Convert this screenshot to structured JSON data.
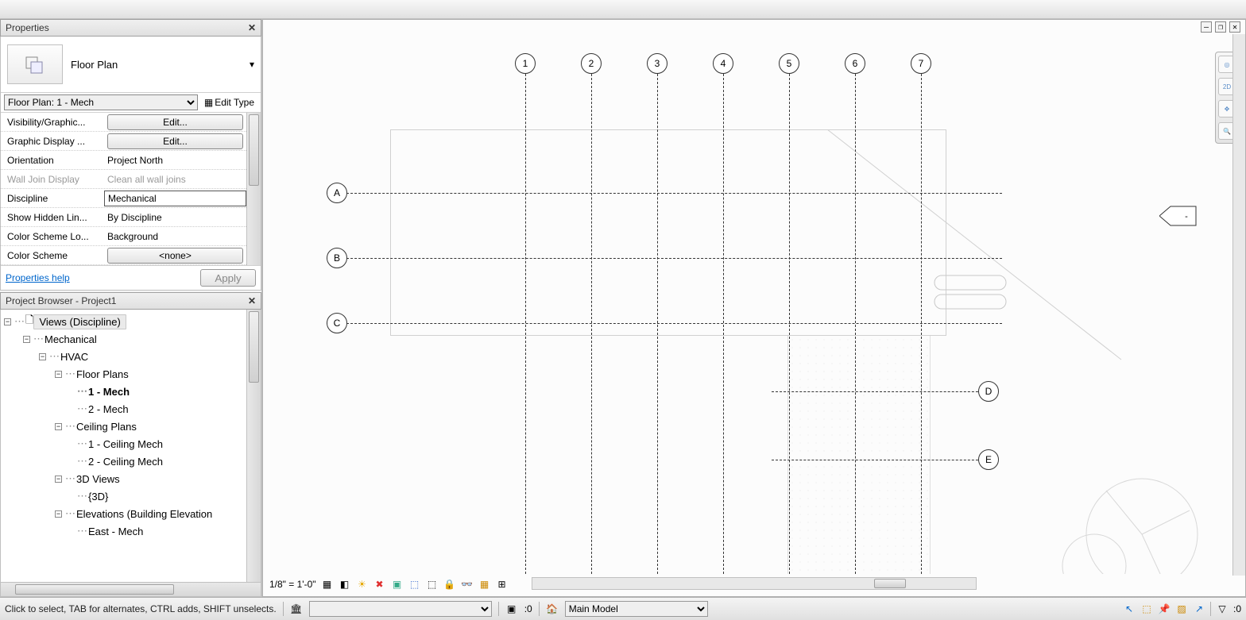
{
  "properties": {
    "title": "Properties",
    "type_label": "Floor Plan",
    "instance": "Floor Plan: 1 - Mech",
    "edit_type": "Edit Type",
    "rows": [
      {
        "label": "Visibility/Graphic...",
        "value": "Edit...",
        "kind": "button"
      },
      {
        "label": "Graphic Display ...",
        "value": "Edit...",
        "kind": "button"
      },
      {
        "label": "Orientation",
        "value": "Project North",
        "kind": "text"
      },
      {
        "label": "Wall Join Display",
        "value": "Clean all wall joins",
        "kind": "disabled"
      },
      {
        "label": "Discipline",
        "value": "Mechanical",
        "kind": "boxed"
      },
      {
        "label": "Show Hidden Lin...",
        "value": "By Discipline",
        "kind": "text"
      },
      {
        "label": "Color Scheme Lo...",
        "value": "Background",
        "kind": "text"
      },
      {
        "label": "Color Scheme",
        "value": "<none>",
        "kind": "button"
      }
    ],
    "help": "Properties help",
    "apply": "Apply"
  },
  "browser": {
    "title": "Project Browser - Project1",
    "root": "Views (Discipline)",
    "tree": [
      {
        "l": 1,
        "t": "Mechanical",
        "exp": "-"
      },
      {
        "l": 2,
        "t": "HVAC",
        "exp": "-"
      },
      {
        "l": 3,
        "t": "Floor Plans",
        "exp": "-"
      },
      {
        "l": 4,
        "t": "1 - Mech",
        "bold": true
      },
      {
        "l": 4,
        "t": "2 - Mech"
      },
      {
        "l": 3,
        "t": "Ceiling Plans",
        "exp": "-"
      },
      {
        "l": 4,
        "t": "1 - Ceiling Mech"
      },
      {
        "l": 4,
        "t": "2 - Ceiling Mech"
      },
      {
        "l": 3,
        "t": "3D Views",
        "exp": "-"
      },
      {
        "l": 4,
        "t": "{3D}"
      },
      {
        "l": 3,
        "t": "Elevations (Building Elevation",
        "exp": "-"
      },
      {
        "l": 4,
        "t": "East - Mech"
      }
    ]
  },
  "drawing": {
    "scale": "1/8\" = 1'-0\"",
    "grids_v": [
      "1",
      "2",
      "3",
      "4",
      "5",
      "6",
      "7"
    ],
    "grids_h": [
      "A",
      "B",
      "C"
    ],
    "grids_h2": [
      "D",
      "E"
    ],
    "elev_label": "-"
  },
  "status": {
    "hint": "Click to select, TAB for alternates, CTRL adds, SHIFT unselects.",
    "count": ":0",
    "workset": "Main Model",
    "filter": ":0"
  },
  "nav": {
    "b2d": "2D"
  }
}
